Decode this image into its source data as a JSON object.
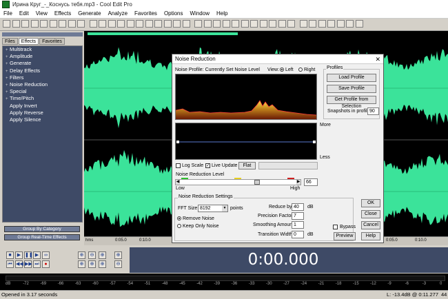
{
  "window": {
    "title": "Ирина Круг_-_Коснусь тебя.mp3 - Cool Edit Pro"
  },
  "menu": [
    "File",
    "Edit",
    "View",
    "Effects",
    "Generate",
    "Analyze",
    "Favorites",
    "Options",
    "Window",
    "Help"
  ],
  "left_panel": {
    "tabs": [
      "Files",
      "Effects",
      "Favorites"
    ],
    "active_tab": "Effects",
    "items": [
      {
        "label": "Multitrack",
        "expand": "+"
      },
      {
        "label": "Amplitude",
        "expand": "+"
      },
      {
        "label": "Generate",
        "expand": "+"
      },
      {
        "label": "Delay Effects",
        "expand": "+"
      },
      {
        "label": "Filters",
        "expand": "+"
      },
      {
        "label": "Noise Reduction",
        "expand": "+"
      },
      {
        "label": "Special",
        "expand": "+"
      },
      {
        "label": "Time/Pitch",
        "expand": "+"
      },
      {
        "label": "Apply Invert",
        "expand": ""
      },
      {
        "label": "Apply Reverse",
        "expand": ""
      },
      {
        "label": "Apply Silence",
        "expand": ""
      }
    ],
    "group_by_category": "Group By Category",
    "group_realtime": "Group Real-Time Effects"
  },
  "timeline": {
    "ticks": [
      "hms",
      "0:05.0",
      "0:10.0",
      "0:05.0",
      "0:10.0",
      "0:05.0",
      "0:10.0"
    ]
  },
  "time_display": "0:00.000",
  "level_meter": {
    "labels": [
      "dB",
      "-72",
      "-69",
      "-66",
      "-63",
      "-60",
      "-57",
      "-54",
      "-51",
      "-48",
      "-45",
      "-42",
      "-39",
      "-36",
      "-33",
      "-30",
      "-27",
      "-24",
      "-21",
      "-18",
      "-15",
      "-12",
      "-9",
      "-6",
      "-3",
      "0"
    ]
  },
  "status": {
    "left": "Opened in 3.17 seconds",
    "level": "L: -13.4dB @ 0:11.277",
    "extra": "44"
  },
  "dialog": {
    "title": "Noise Reduction",
    "close_icon": "close-icon",
    "profile_label": "Noise Profile: Currently Set Noise Level",
    "view_label": "View:",
    "view_left": "Left",
    "view_right": "Right",
    "view_selected": "Left",
    "more_label": "More",
    "less_label": "Less",
    "log_scale": "Log Scale",
    "log_scale_checked": false,
    "live_update": "Live Update",
    "live_update_checked": true,
    "flat_button": "Flat",
    "nr_level_label": "Noise Reduction Level",
    "low_label": "Low",
    "high_label": "High",
    "nr_level_value": "66",
    "profiles_group": "Profiles",
    "load_profile": "Load Profile",
    "save_profile": "Save Profile",
    "get_profile": "Get Profile from Selection",
    "snapshots_label": "Snapshots in profile",
    "snapshots_value": "90",
    "settings_group": "Noise Reduction Settings",
    "fft_label": "FFT Size",
    "fft_value": "8192",
    "points_label": "points",
    "remove_noise": "Remove Noise",
    "keep_noise": "Keep Only Noise",
    "remove_selected": true,
    "reduce_by_label": "Reduce by",
    "reduce_by_value": "40",
    "reduce_by_unit": "dB",
    "precision_label": "Precision Factor",
    "precision_value": "7",
    "smoothing_label": "Smoothing Amount",
    "smoothing_value": "1",
    "transition_label": "Transition Width",
    "transition_value": "0",
    "transition_unit": "dB",
    "ok": "OK",
    "close": "Close",
    "cancel": "Cancel",
    "bypass": "Bypass",
    "preview": "Preview",
    "help": "Help"
  }
}
